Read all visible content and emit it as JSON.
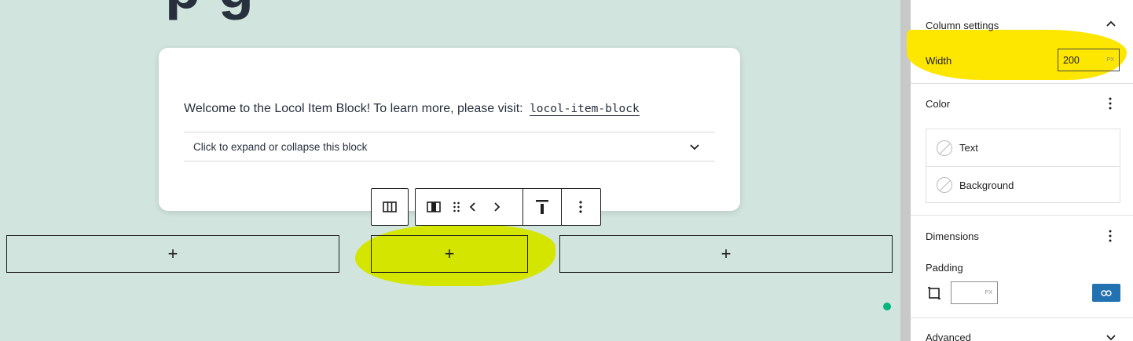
{
  "canvas": {
    "heading_remnant": "p         g",
    "card": {
      "intro_text": "Welcome to the Locol Item Block! To learn more, please visit:",
      "link_text": "locol-item-block",
      "accordion_label": "Click to expand or collapse this block"
    },
    "toolbar": {
      "icons": [
        "columns-icon",
        "column-icon",
        "drag-handle-icon",
        "chevron-left-icon",
        "chevron-right-icon",
        "align-top-icon",
        "more-options-icon"
      ]
    },
    "columns": [
      {
        "label": "+"
      },
      {
        "label": "+"
      },
      {
        "label": "+"
      }
    ]
  },
  "sidebar": {
    "column_settings": {
      "title": "Column settings",
      "width_label": "Width",
      "width_value": "200",
      "width_unit": "PX"
    },
    "color": {
      "title": "Color",
      "items": [
        {
          "label": "Text"
        },
        {
          "label": "Background"
        }
      ]
    },
    "dimensions": {
      "title": "Dimensions",
      "padding_label": "Padding",
      "padding_value": "",
      "padding_unit": "PX"
    },
    "advanced": {
      "title": "Advanced"
    }
  },
  "colors": {
    "canvas_bg": "#d1e4dd",
    "highlight_yellow": "#fde600",
    "highlight_green": "#d4e600",
    "accent_blue": "#2271b1",
    "indicator_green": "#00b67a"
  }
}
